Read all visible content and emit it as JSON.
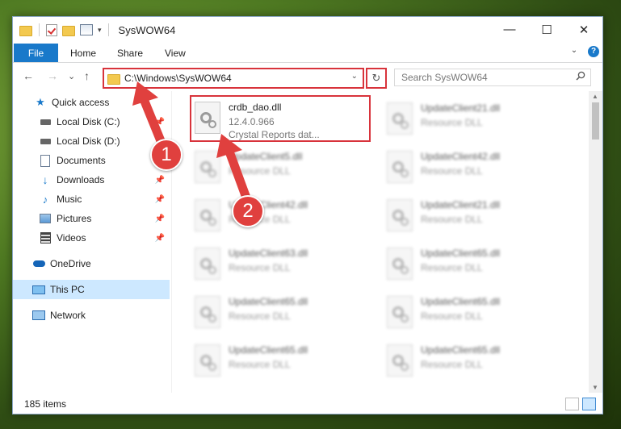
{
  "window": {
    "title": "SysWOW64",
    "controls": {
      "minimize": "—",
      "maximize": "☐",
      "close": "✕"
    }
  },
  "ribbon": {
    "file_tab": "File",
    "tabs": [
      "Home",
      "Share",
      "View"
    ],
    "help": "?"
  },
  "nav": {
    "back": "←",
    "forward": "→",
    "recent": "⌄",
    "up": "↑",
    "address": "C:\\Windows\\SysWOW64",
    "refresh": "↻",
    "search_placeholder": "Search SysWOW64"
  },
  "sidebar": {
    "items": [
      {
        "label": "Quick access",
        "icon": "star-icon",
        "pinned": false
      },
      {
        "label": "Local Disk (C:)",
        "icon": "drive-icon",
        "pinned": true
      },
      {
        "label": "Local Disk (D:)",
        "icon": "drive-icon",
        "pinned": false
      },
      {
        "label": "Documents",
        "icon": "document-icon",
        "pinned": true
      },
      {
        "label": "Downloads",
        "icon": "download-icon",
        "pinned": true
      },
      {
        "label": "Music",
        "icon": "music-icon",
        "pinned": true
      },
      {
        "label": "Pictures",
        "icon": "pictures-icon",
        "pinned": true
      },
      {
        "label": "Videos",
        "icon": "videos-icon",
        "pinned": true
      },
      {
        "label": "OneDrive",
        "icon": "cloud-icon",
        "pinned": false
      },
      {
        "label": "This PC",
        "icon": "computer-icon",
        "pinned": false,
        "selected": true
      },
      {
        "label": "Network",
        "icon": "network-icon",
        "pinned": false
      }
    ]
  },
  "files": {
    "highlighted": {
      "name": "crdb_dao.dll",
      "version": "12.4.0.966",
      "desc": "Crystal Reports dat..."
    },
    "col1": [
      {
        "name": "UpdateClient5.dll",
        "desc": "Resource DLL"
      },
      {
        "name": "UpdateClient42.dll",
        "desc": "Resource DLL"
      },
      {
        "name": "UpdateClient63.dll",
        "desc": "Resource DLL"
      },
      {
        "name": "UpdateClient65.dll",
        "desc": "Resource DLL"
      },
      {
        "name": "UpdateClient65.dll",
        "desc": "Resource DLL"
      }
    ],
    "col2": [
      {
        "name": "UpdateClient21.dll",
        "desc": "Resource DLL"
      },
      {
        "name": "UpdateClient42.dll",
        "desc": "Resource DLL"
      },
      {
        "name": "UpdateClient21.dll",
        "desc": "Resource DLL"
      },
      {
        "name": "UpdateClient65.dll",
        "desc": "Resource DLL"
      },
      {
        "name": "UpdateClient65.dll",
        "desc": "Resource DLL"
      },
      {
        "name": "UpdateClient65.dll",
        "desc": "Resource DLL"
      }
    ]
  },
  "status": {
    "count": "185 items"
  },
  "annotations": {
    "step1": "1",
    "step2": "2"
  },
  "colors": {
    "accent": "#1979ca",
    "highlight": "#d8333b",
    "badge": "#e0403e",
    "selected": "#cde8ff"
  }
}
